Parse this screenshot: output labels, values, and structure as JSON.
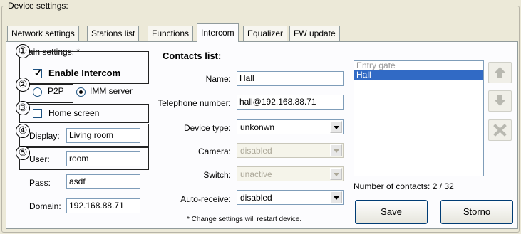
{
  "group_title": "Device settings:",
  "tabs": [
    {
      "label": "Network settings"
    },
    {
      "label": "Stations list"
    },
    {
      "label": "Functions"
    },
    {
      "label": "Intercom"
    },
    {
      "label": "Equalizer"
    },
    {
      "label": "FW update"
    }
  ],
  "main_settings": {
    "title": "Main settings: *",
    "enable_intercom_label": "Enable Intercom",
    "p2p_label": "P2P",
    "imm_server_label": "IMM server",
    "home_screen_label": "Home screen",
    "display_label": "Display:",
    "display_value": "Living room",
    "user_label": "User:",
    "user_value": "room",
    "pass_label": "Pass:",
    "pass_value": "asdf",
    "domain_label": "Domain:",
    "domain_value": "192.168.88.71"
  },
  "contacts": {
    "title": "Contacts list:",
    "name_label": "Name:",
    "name_value": "Hall",
    "phone_label": "Telephone number:",
    "phone_value": "hall@192.168.88.71",
    "device_type_label": "Device type:",
    "device_type_value": "unkonwn",
    "camera_label": "Camera:",
    "camera_value": "disabled",
    "switch_label": "Switch:",
    "switch_value": "unactive",
    "auto_receive_label": "Auto-receive:",
    "auto_receive_value": "disabled",
    "note": "* Change settings will restart device.",
    "list_items": [
      "Entry gate",
      "Hall"
    ],
    "count_text": "Number of contacts: 2 / 32",
    "save_label": "Save",
    "storno_label": "Storno"
  },
  "annotations": [
    "①",
    "②",
    "③",
    "④",
    "⑤"
  ]
}
